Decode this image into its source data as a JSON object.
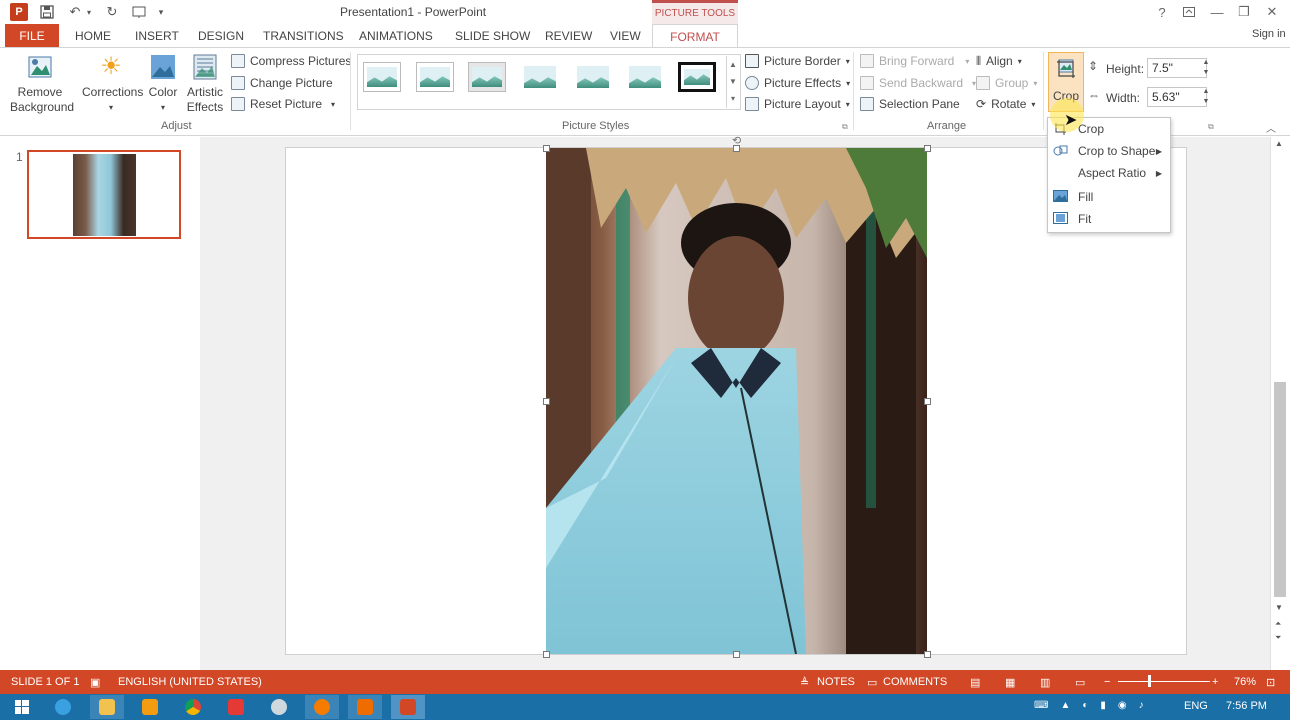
{
  "window": {
    "title": "Presentation1 - PowerPoint",
    "context_tab_title": "PICTURE TOOLS",
    "help": "?",
    "signin": "Sign in"
  },
  "tabs": [
    {
      "label": "FILE"
    },
    {
      "label": "HOME"
    },
    {
      "label": "INSERT"
    },
    {
      "label": "DESIGN"
    },
    {
      "label": "TRANSITIONS"
    },
    {
      "label": "ANIMATIONS"
    },
    {
      "label": "SLIDE SHOW"
    },
    {
      "label": "REVIEW"
    },
    {
      "label": "VIEW"
    },
    {
      "label": "FORMAT"
    }
  ],
  "ribbon": {
    "adjust": {
      "remove_background_1": "Remove",
      "remove_background_2": "Background",
      "corrections": "Corrections",
      "color": "Color",
      "artistic_1": "Artistic",
      "artistic_2": "Effects",
      "compress": "Compress Pictures",
      "change": "Change Picture",
      "reset": "Reset Picture",
      "group_label": "Adjust"
    },
    "picture_styles": {
      "border": "Picture Border",
      "effects": "Picture Effects",
      "layout": "Picture Layout",
      "group_label": "Picture Styles"
    },
    "arrange": {
      "bring_forward": "Bring Forward",
      "send_backward": "Send Backward",
      "selection_pane": "Selection Pane",
      "align": "Align",
      "group": "Group",
      "rotate": "Rotate",
      "group_label": "Arrange"
    },
    "size": {
      "crop": "Crop",
      "height_label": "Height:",
      "height_value": "7.5\"",
      "width_label": "Width:",
      "width_value": "5.63\""
    }
  },
  "crop_menu": {
    "items": [
      {
        "label": "Crop"
      },
      {
        "label": "Crop to Shape"
      },
      {
        "label": "Aspect Ratio"
      },
      {
        "label": "Fill"
      },
      {
        "label": "Fit"
      }
    ]
  },
  "slides_pane": {
    "slide_number": "1"
  },
  "status": {
    "slide_info": "SLIDE 1 OF 1",
    "language": "ENGLISH (UNITED STATES)",
    "notes": "NOTES",
    "comments": "COMMENTS",
    "zoom": "76%"
  },
  "taskbar": {
    "lang": "ENG",
    "time": "7:56 PM"
  },
  "colors": {
    "accent": "#d24726",
    "context": "#c0504d",
    "taskbar": "#1a6fa6"
  }
}
